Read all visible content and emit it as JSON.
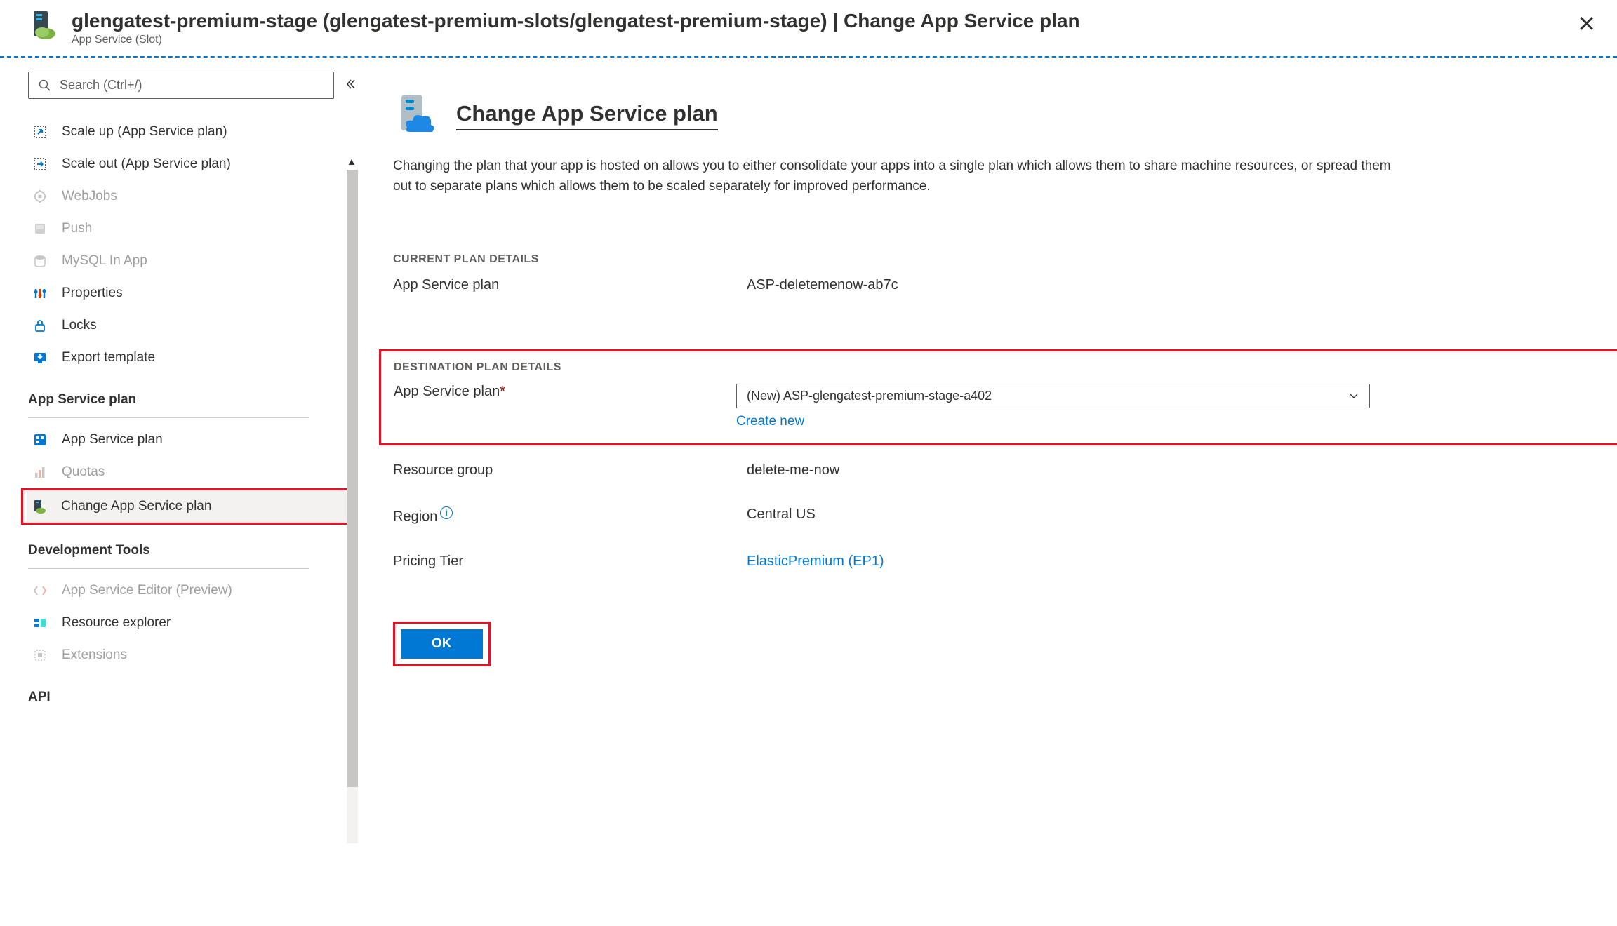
{
  "header": {
    "title": "glengatest-premium-stage (glengatest-premium-slots/glengatest-premium-stage) | Change App Service plan",
    "subtitle": "App Service (Slot)"
  },
  "search": {
    "placeholder": "Search (Ctrl+/)"
  },
  "nav": {
    "items_top": [
      {
        "label": "Scale up (App Service plan)",
        "icon": "scale-up"
      },
      {
        "label": "Scale out (App Service plan)",
        "icon": "scale-out"
      },
      {
        "label": "WebJobs",
        "icon": "webjobs",
        "disabled": true
      },
      {
        "label": "Push",
        "icon": "push",
        "disabled": true
      },
      {
        "label": "MySQL In App",
        "icon": "mysql",
        "disabled": true
      },
      {
        "label": "Properties",
        "icon": "properties"
      },
      {
        "label": "Locks",
        "icon": "locks"
      },
      {
        "label": "Export template",
        "icon": "export"
      }
    ],
    "section_asp": "App Service plan",
    "items_asp": [
      {
        "label": "App Service plan",
        "icon": "asp"
      },
      {
        "label": "Quotas",
        "icon": "quotas",
        "disabled": true
      },
      {
        "label": "Change App Service plan",
        "icon": "change-asp",
        "selected": true
      }
    ],
    "section_dev": "Development Tools",
    "items_dev": [
      {
        "label": "App Service Editor (Preview)",
        "icon": "editor",
        "disabled": true
      },
      {
        "label": "Resource explorer",
        "icon": "resource-explorer"
      },
      {
        "label": "Extensions",
        "icon": "extensions",
        "disabled": true
      }
    ],
    "section_api": "API"
  },
  "main": {
    "title": "Change App Service plan",
    "description": "Changing the plan that your app is hosted on allows you to either consolidate your apps into a single plan which allows them to share machine resources, or spread them out to separate plans which allows them to be scaled separately for improved performance.",
    "current_section": "CURRENT PLAN DETAILS",
    "current_plan_label": "App Service plan",
    "current_plan_value": "ASP-deletemenow-ab7c",
    "dest_section": "DESTINATION PLAN DETAILS",
    "dest_plan_label": "App Service plan",
    "dest_plan_value": "(New) ASP-glengatest-premium-stage-a402",
    "create_new": "Create new",
    "rg_label": "Resource group",
    "rg_value": "delete-me-now",
    "region_label": "Region",
    "region_value": "Central US",
    "tier_label": "Pricing Tier",
    "tier_value": "ElasticPremium (EP1)",
    "ok": "OK"
  }
}
